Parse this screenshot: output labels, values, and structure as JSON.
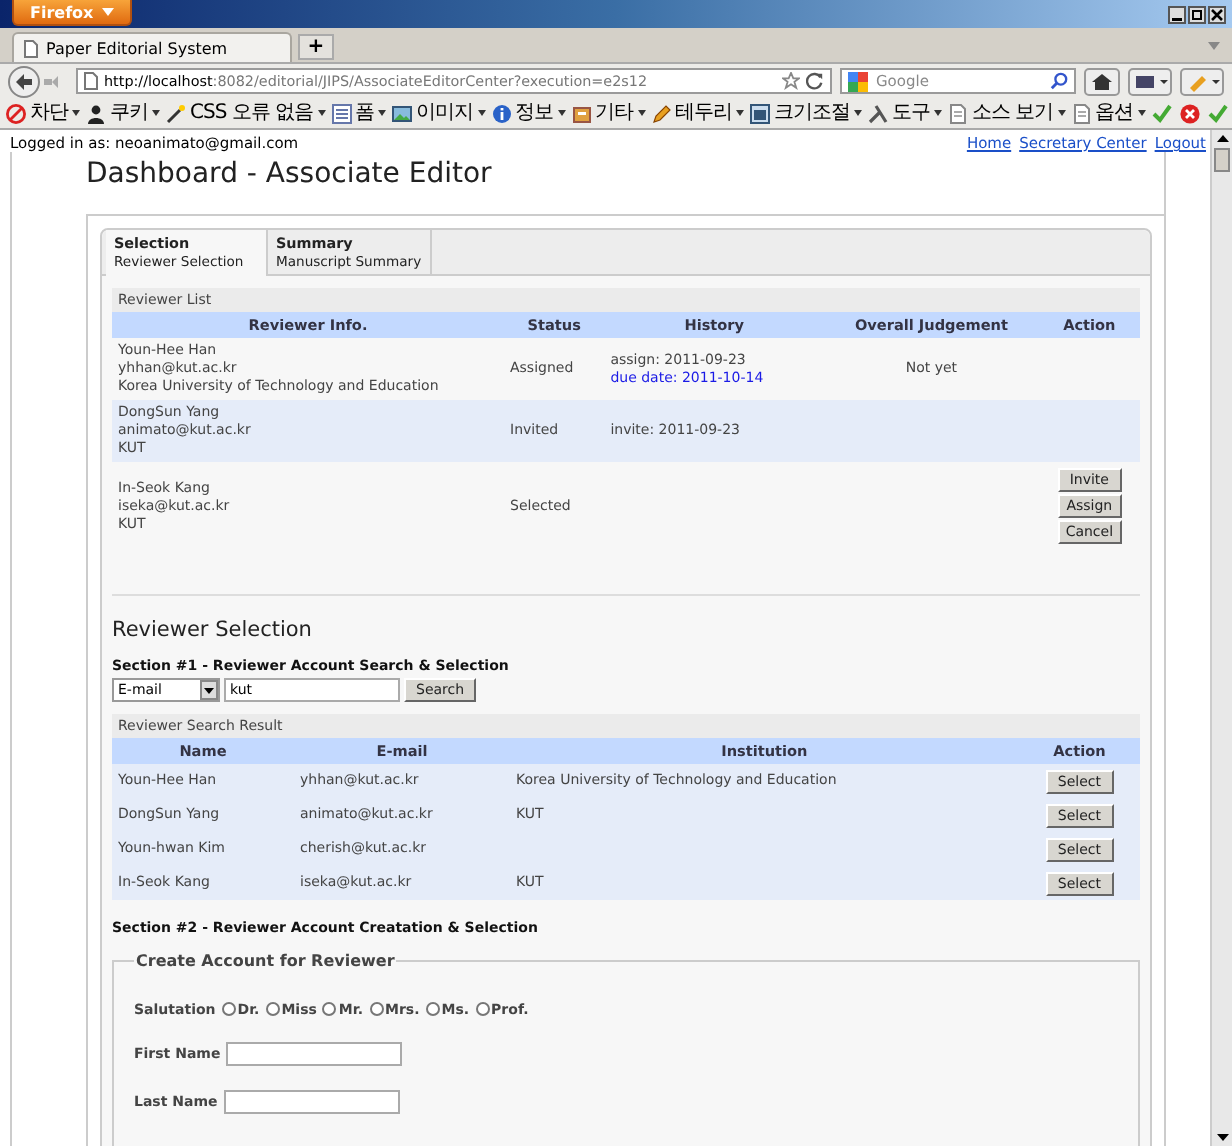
{
  "browser": {
    "menu_button": "Firefox",
    "tab_title": "Paper Editorial System",
    "new_tab": "+",
    "url_host": "http://localhost",
    "url_rest": ":8082/editorial/JIPS/AssociateEditorCenter?execution=e2s12",
    "search_placeholder": "Google",
    "toolbar": [
      {
        "label": "차단"
      },
      {
        "label": "쿠키"
      },
      {
        "label": "CSS 오류 없음"
      },
      {
        "label": "폼"
      },
      {
        "label": "이미지"
      },
      {
        "label": "정보"
      },
      {
        "label": "기타"
      },
      {
        "label": "테두리"
      },
      {
        "label": "크기조절"
      },
      {
        "label": "도구"
      },
      {
        "label": "소스 보기"
      },
      {
        "label": "옵션"
      }
    ]
  },
  "page": {
    "logged_in": "Logged in as: neoanimato@gmail.com",
    "nav_links": [
      "Home",
      "Secretary Center",
      "Logout"
    ],
    "title": "Dashboard - Associate Editor",
    "tabs": [
      {
        "title": "Selection",
        "subtitle": "Reviewer Selection",
        "selected": true
      },
      {
        "title": "Summary",
        "subtitle": "Manuscript Summary",
        "selected": false
      }
    ],
    "reviewer_list": {
      "caption": "Reviewer List",
      "columns": [
        "Reviewer Info.",
        "Status",
        "History",
        "Overall Judgement",
        "Action"
      ],
      "rows": [
        {
          "name": "Youn-Hee Han",
          "email": "yhhan@kut.ac.kr",
          "affiliation": "Korea University of Technology and Education",
          "status": "Assigned",
          "history": [
            {
              "text": "assign: 2011-09-23",
              "kind": "plain"
            },
            {
              "text": "due date: 2011-10-14",
              "kind": "due"
            }
          ],
          "judgement": "Not yet",
          "actions": []
        },
        {
          "name": "DongSun Yang",
          "email": "animato@kut.ac.kr",
          "affiliation": "KUT",
          "status": "Invited",
          "history": [
            {
              "text": "invite: 2011-09-23",
              "kind": "plain"
            }
          ],
          "actions": []
        },
        {
          "name": "In-Seok Kang",
          "email": "iseka@kut.ac.kr",
          "affiliation": "KUT",
          "status": "Selected",
          "history": [],
          "actions": [
            "Invite",
            "Assign",
            "Cancel"
          ]
        }
      ]
    },
    "selection": {
      "heading": "Reviewer Selection",
      "section1": "Section #1 - Reviewer Account Search & Selection",
      "search_field": "E-mail",
      "query": "kut",
      "search_button": "Search",
      "result": {
        "caption": "Reviewer Search Result",
        "columns": [
          "Name",
          "E-mail",
          "Institution",
          "Action"
        ],
        "rows": [
          {
            "name": "Youn-Hee Han",
            "email": "yhhan@kut.ac.kr",
            "institution": "Korea University of Technology and Education",
            "action": "Select"
          },
          {
            "name": "DongSun Yang",
            "email": "animato@kut.ac.kr",
            "institution": "KUT",
            "action": "Select"
          },
          {
            "name": "Youn-hwan Kim",
            "email": "cherish@kut.ac.kr",
            "action": "Select"
          },
          {
            "name": "In-Seok Kang",
            "email": "iseka@kut.ac.kr",
            "institution": "KUT",
            "action": "Select"
          }
        ]
      },
      "section2": "Section #2 - Reviewer Account Creatation & Selection",
      "fieldset": {
        "legend": "Create Account for Reviewer",
        "salutation_label": "Salutation",
        "salutations": [
          {
            "label": "Dr.",
            "selected": false
          },
          {
            "label": "Miss",
            "selected": false
          },
          {
            "label": "Mr.",
            "selected": false
          },
          {
            "label": "Mrs.",
            "selected": false
          },
          {
            "label": "Ms.",
            "selected": false
          },
          {
            "label": "Prof.",
            "selected": false
          }
        ],
        "fields": [
          {
            "label": "First Name"
          },
          {
            "label": "Last Name"
          }
        ]
      }
    }
  }
}
